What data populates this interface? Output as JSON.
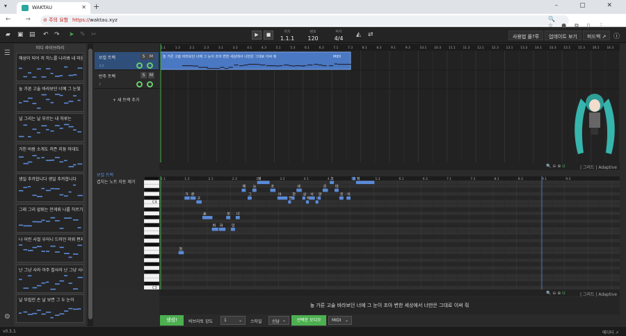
{
  "browser": {
    "tab_title": "WAKTAU",
    "new_tab": "+",
    "nav_icons": "← → ↻",
    "security_label": "주의 요함",
    "url_scheme": "https://",
    "url_host": "waktau.xyz",
    "window_controls": "– ▢ ✕"
  },
  "toolbar": {
    "transport": {
      "play": "▶",
      "stop": "■"
    },
    "position": {
      "label": "위치",
      "value": "1.1.1"
    },
    "tempo": {
      "label": "템포",
      "value": "120"
    },
    "meter": {
      "label": "박자",
      "value": "4/4"
    },
    "buttons": {
      "howto": "사용법 몰?루",
      "updates": "업데이트 보기",
      "feedback": "피드백 ↗"
    }
  },
  "library": {
    "title": "미디 라이브러리",
    "items": [
      {
        "title": "해성이 되어 저 하느를 나라봐 내 마음"
      },
      {
        "title": "높 가른 고술 바라보던 너예 그 눈빛"
      },
      {
        "title": "널 그리는 날 부르는 내 하루는"
      },
      {
        "title": "거친 바람 소게도 저즌 지듕 미데도"
      },
      {
        "title": "생일 추카합니다 생일 추카합니다"
      },
      {
        "title": "그래 그리 쉽튀는 안게뤼 나를 허르기"
      },
      {
        "title": "나 어린 사절 우어니 드러던 미뤼 편지"
      },
      {
        "title": "난 그냥 사라 아주 찰사라 난 그냥 사라"
      },
      {
        "title": "날 부럽민 손 날 보면 그 두 눈이"
      }
    ]
  },
  "tracks": [
    {
      "name": "보컬 트랙",
      "solo": "S",
      "mute": "M",
      "sub": "ㅈ?"
    },
    {
      "name": "반주 트랙",
      "solo": "S",
      "mute": "M",
      "sub": "♪"
    }
  ],
  "add_track": "+ 새 트랙 추가",
  "arrange": {
    "clip_text": "높 가른 고술 바라보던 너예 그 눈이 조아 변한 세상에서 너만은 그대로 이써 줘",
    "clip_tag": "MIDI",
    "ruler": [
      "1.1",
      "1.3",
      "2.1",
      "2.3",
      "3.1",
      "3.3",
      "4.1",
      "4.3",
      "5.1",
      "5.3",
      "6.1",
      "6.3",
      "7.1",
      "7.3",
      "8.1",
      "8.3",
      "9.1",
      "9.3",
      "10.1",
      "10.3",
      "11.1",
      "11.3",
      "12.1",
      "12.3",
      "13.1",
      "13.3",
      "14.1",
      "14.3",
      "15.1",
      "15.3",
      "16.1",
      "16.3",
      "17.1"
    ],
    "zoom_grid": "| 그리드 | Adaptive"
  },
  "piano_roll": {
    "title": "보컬 트랙",
    "option": "겹치는 노트 자동 제거",
    "c4": "C4",
    "c3": "C3",
    "ruler": [
      "1.1",
      "1.3",
      "2.1",
      "2.3",
      "3.1",
      "3.3",
      "4.1",
      "4.3",
      "5.1",
      "5.3",
      "6.1",
      "6.3",
      "7.1",
      "7.3",
      "8.1",
      "8.3",
      "9.1",
      "9.3"
    ],
    "notes": [
      {
        "lyric": "늘",
        "bar": 2.5,
        "len": 0.5,
        "pitch": -12
      },
      {
        "lyric": "가",
        "bar": 3.0,
        "len": 0.5,
        "pitch": 2
      },
      {
        "lyric": "른",
        "bar": 3.5,
        "len": 0.5,
        "pitch": 2
      },
      {
        "lyric": "고",
        "bar": 4.0,
        "len": 0.5,
        "pitch": 1
      },
      {
        "lyric": "술",
        "bar": 4.5,
        "len": 0.9,
        "pitch": -3
      },
      {
        "lyric": "바",
        "bar": 5.3,
        "len": 0.6,
        "pitch": -6
      },
      {
        "lyric": "라",
        "bar": 5.9,
        "len": 0.6,
        "pitch": -6
      },
      {
        "lyric": "보",
        "bar": 6.5,
        "len": 0.4,
        "pitch": -3
      },
      {
        "lyric": "던",
        "bar": 6.9,
        "len": 0.4,
        "pitch": -6
      },
      {
        "lyric": "너",
        "bar": 7.3,
        "len": 0.4,
        "pitch": -3
      },
      {
        "lyric": "예",
        "bar": 7.8,
        "len": 0.4,
        "pitch": 4
      },
      {
        "lyric": "그",
        "bar": 8.3,
        "len": 0.4,
        "pitch": 2
      },
      {
        "lyric": "눈",
        "bar": 8.7,
        "len": 0.4,
        "pitch": 4
      },
      {
        "lyric": "이",
        "bar": 9.1,
        "len": 1.1,
        "pitch": 6
      },
      {
        "lyric": "조",
        "bar": 10.2,
        "len": 0.5,
        "pitch": 4
      },
      {
        "lyric": "아",
        "bar": 10.8,
        "len": 0.9,
        "pitch": 2
      },
      {
        "lyric": "변",
        "bar": 11.7,
        "len": 0.3,
        "pitch": 1
      },
      {
        "lyric": "한",
        "bar": 12.0,
        "len": 0.3,
        "pitch": 2
      },
      {
        "lyric": "세",
        "bar": 12.4,
        "len": 0.5,
        "pitch": 4
      },
      {
        "lyric": "상",
        "bar": 12.9,
        "len": 0.3,
        "pitch": 2
      },
      {
        "lyric": "에",
        "bar": 13.2,
        "len": 0.3,
        "pitch": 1
      },
      {
        "lyric": "서",
        "bar": 13.5,
        "len": 0.5,
        "pitch": 2
      },
      {
        "lyric": "너",
        "bar": 14.0,
        "len": 0.3,
        "pitch": 1
      },
      {
        "lyric": "만",
        "bar": 14.2,
        "len": 0.3,
        "pitch": 2
      },
      {
        "lyric": "은",
        "bar": 14.6,
        "len": 0.5,
        "pitch": 4
      },
      {
        "lyric": "그",
        "bar": 15.2,
        "len": 0.4,
        "pitch": 6
      },
      {
        "lyric": "대",
        "bar": 15.6,
        "len": 0.4,
        "pitch": 4
      },
      {
        "lyric": "로",
        "bar": 16.0,
        "len": 0.4,
        "pitch": 2
      },
      {
        "lyric": "이",
        "bar": 16.6,
        "len": 0.4,
        "pitch": 2
      },
      {
        "lyric": "써",
        "bar": 17.1,
        "len": 0.3,
        "pitch": 7
      },
      {
        "lyric": "줘",
        "bar": 17.4,
        "len": 1.6,
        "pitch": 6
      }
    ]
  },
  "lyrics_line": "높 가른 고술 바라보던 너예 그 눈이 조아 변한 세상에서 너만은 그대로 이써 줘",
  "bottom": {
    "generate": "생성!",
    "vibrato_label": "비브라토 강도",
    "vibrato_value": "1",
    "style_label": "스타일",
    "style_value": "신남",
    "selected_audio": "선택한 오디오",
    "midi": "MIDI"
  },
  "status": {
    "version": "v0.5.1",
    "editor": "에디터 ↗"
  },
  "colors": {
    "note": "#5b8bd9",
    "accent": "#4caf50",
    "bg": "#2b2b2b"
  }
}
